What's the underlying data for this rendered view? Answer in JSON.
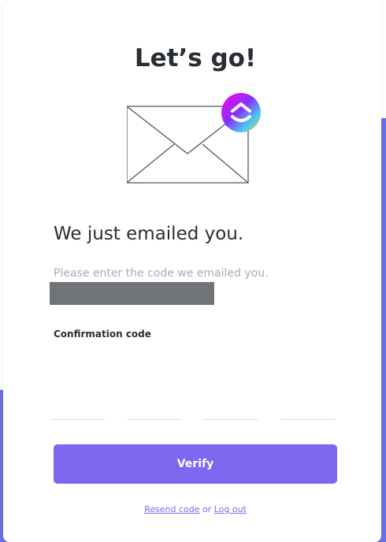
{
  "page": {
    "title": "Let’s go!",
    "heading": "We just emailed you.",
    "subtext": "Please enter the code we emailed you."
  },
  "form": {
    "code_label": "Confirmation code",
    "code_boxes": [
      "",
      "",
      "",
      ""
    ],
    "verify_label": "Verify"
  },
  "footer": {
    "resend_label": "Resend code",
    "separator": " or ",
    "logout_label": "Log out"
  },
  "colors": {
    "accent": "#7b68ee",
    "background_band": "#6a6fe3",
    "text_dark": "#292d34",
    "text_muted": "#a8abb1"
  },
  "icons": {
    "envelope": "envelope-icon",
    "logo": "clickup-logo-icon"
  }
}
